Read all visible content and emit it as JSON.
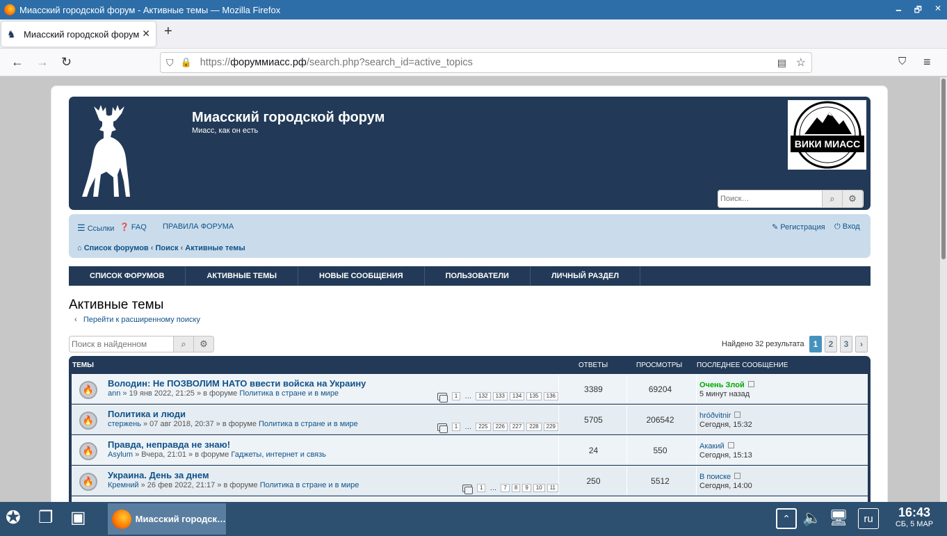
{
  "window": {
    "title": "Миасский городской форум - Активные темы — Mozilla Firefox"
  },
  "browser": {
    "tab_label": "Миасский городской форум",
    "url_prefix": "https://",
    "url_host": "форуммиасс.рф",
    "url_path": "/search.php?search_id=active_topics"
  },
  "header": {
    "site_title": "Миасский городской форум",
    "site_desc": "Миасс, как он есть",
    "wiki_logo_text": "ВИКИ МИАСС",
    "search_placeholder": "Поиск…"
  },
  "navpanel": {
    "links": "Ссылки",
    "faq": "FAQ",
    "rules": "ПРАВИЛА ФОРУМА",
    "register": "Регистрация",
    "login": "Вход",
    "crumb1": "Список форумов",
    "crumb2": "Поиск",
    "crumb3": "Активные темы"
  },
  "menu": [
    "СПИСОК ФОРУМОВ",
    "АКТИВНЫЕ ТЕМЫ",
    "НОВЫЕ СООБЩЕНИЯ",
    "ПОЛЬЗОВАТЕЛИ",
    "ЛИЧНЫЙ РАЗДЕЛ"
  ],
  "page": {
    "title": "Активные темы",
    "advanced_link": "Перейти к расширенному поиску",
    "search_placeholder": "Поиск в найденном",
    "found": "Найдено 32 результата",
    "pages": [
      "1",
      "2",
      "3"
    ]
  },
  "columns": {
    "topics": "ТЕМЫ",
    "replies": "ОТВЕТЫ",
    "views": "ПРОСМОТРЫ",
    "last": "ПОСЛЕДНЕЕ СООБЩЕНИЕ"
  },
  "topics": [
    {
      "title": "Володин: Не ПОЗВОЛИМ НАТО ввести войска на Украину",
      "author": "ann",
      "meta": " » 19 янв 2022, 21:25 » в форуме ",
      "forum": "Политика в стране и в мире",
      "pages": [
        "1",
        "…",
        "132",
        "133",
        "134",
        "135",
        "136"
      ],
      "replies": "3389",
      "views": "69204",
      "last_user": "Очень Злой",
      "last_time": "5 минут назад"
    },
    {
      "title": "Политика и люди",
      "author": "стержень",
      "meta": " » 07 авг 2018, 20:37 » в форуме ",
      "forum": "Политика в стране и в мире",
      "pages": [
        "1",
        "…",
        "225",
        "226",
        "227",
        "228",
        "229"
      ],
      "replies": "5705",
      "views": "206542",
      "last_user": "hróðvitnir",
      "last_time": "Сегодня, 15:32"
    },
    {
      "title": "Правда, неправда не знаю!",
      "author": "Asylum",
      "meta": " » Вчера, 21:01 » в форуме ",
      "forum": "Гаджеты, интернет и связь",
      "pages": [],
      "replies": "24",
      "views": "550",
      "last_user": "Акакий",
      "last_time": "Сегодня, 15:13"
    },
    {
      "title": "Украина. День за днем",
      "author": "Кремний",
      "meta": " » 26 фев 2022, 21:17 » в форуме ",
      "forum": "Политика в стране и в мире",
      "pages": [
        "1",
        "…",
        "7",
        "8",
        "9",
        "10",
        "11"
      ],
      "replies": "250",
      "views": "5512",
      "last_user": "В поиске",
      "last_time": "Сегодня, 14:00"
    }
  ],
  "taskbar": {
    "app_label": "Миасский городск…",
    "lang": "ru",
    "time": "16:43",
    "date": "СБ, 5 МАР"
  }
}
